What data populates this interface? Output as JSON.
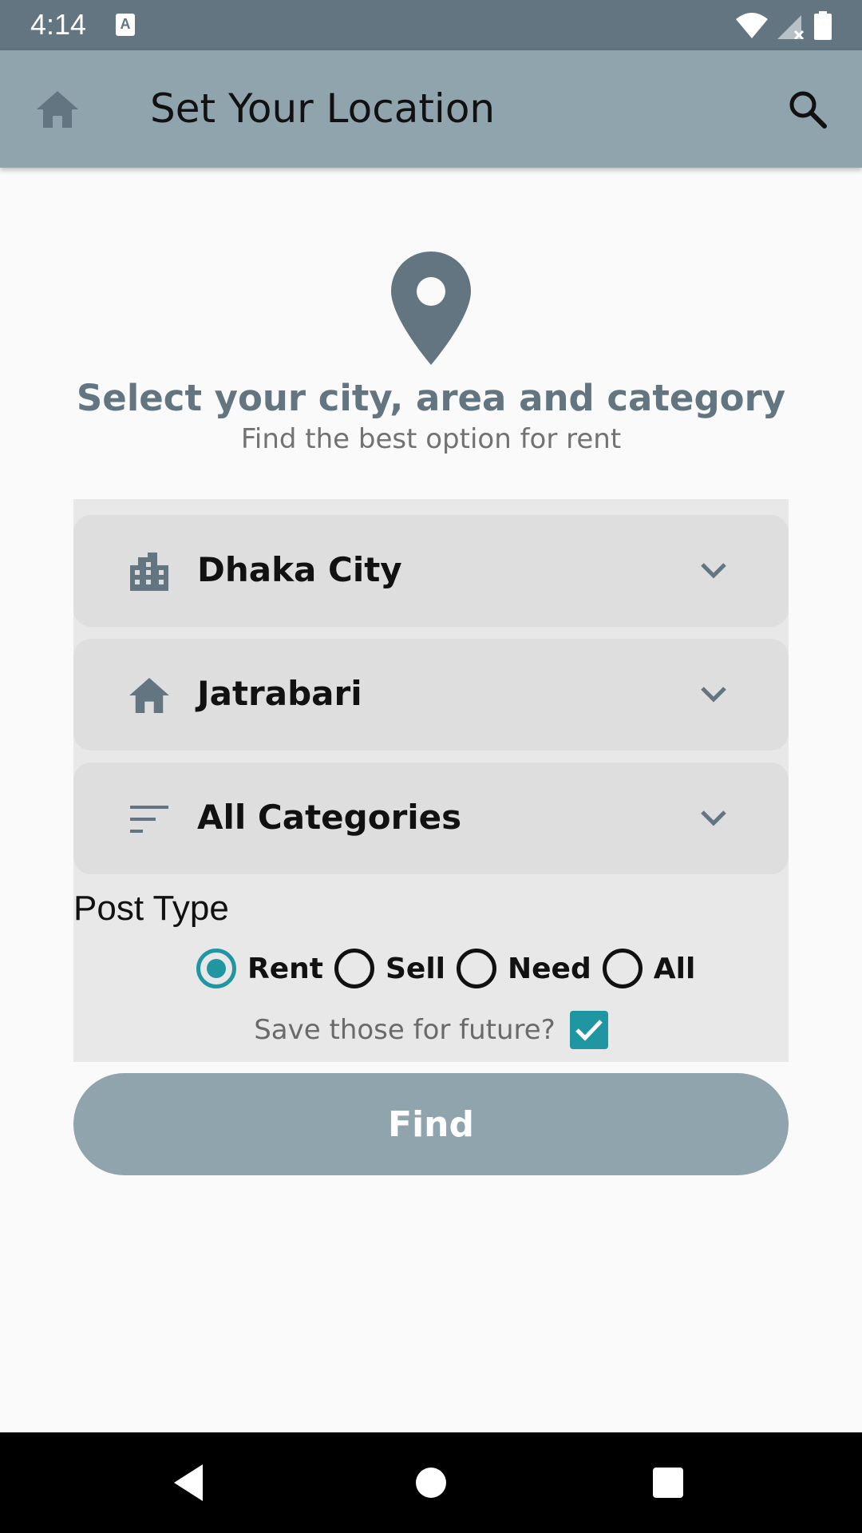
{
  "status_bar": {
    "time": "4:14",
    "notification_icon": "A"
  },
  "app_bar": {
    "title": "Set Your Location",
    "home_icon": "home-icon",
    "search_icon": "search-icon"
  },
  "header": {
    "headline": "Select your city, area and category",
    "subline": "Find the best option for rent"
  },
  "form": {
    "city": {
      "value": "Dhaka City",
      "icon": "city-building-icon"
    },
    "area": {
      "value": "Jatrabari",
      "icon": "home-icon"
    },
    "category": {
      "value": "All Categories",
      "icon": "sort-lines-icon"
    },
    "post_type_label": "Post Type",
    "post_types": [
      {
        "label": "Rent",
        "checked": true
      },
      {
        "label": "Sell",
        "checked": false
      },
      {
        "label": "Need",
        "checked": false
      },
      {
        "label": "All",
        "checked": false
      }
    ],
    "save_label": "Save those for future?",
    "save_checked": true,
    "find_label": "Find"
  },
  "colors": {
    "status_bar": "#627580",
    "app_bar": "#90a4ae",
    "accent": "#2196a3",
    "icon": "#627580"
  }
}
